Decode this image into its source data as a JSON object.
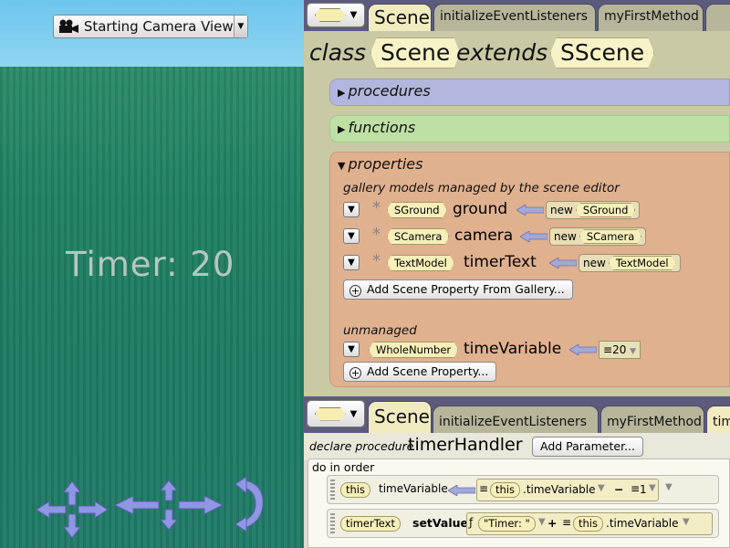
{
  "scene_view": {
    "camera_select": {
      "label": "Starting Camera View",
      "icon": "video-camera-icon"
    },
    "timer_text": "Timer: 20",
    "colors": {
      "sky": "#7ccbef",
      "ground": "#1f7d63"
    }
  },
  "editor_top": {
    "tabs": [
      "Scene",
      "initializeEventListeners",
      "myFirstMethod",
      ""
    ],
    "class_decl": {
      "class_kw": "class",
      "class_name": "Scene",
      "extends_kw": "extends",
      "super_name": "SScene"
    },
    "sections": {
      "procedures": "procedures",
      "functions": "functions",
      "properties": "properties"
    },
    "gallery_heading": "gallery models managed by the scene editor",
    "gallery_props": [
      {
        "type": "SGround",
        "name": "ground",
        "new_kw": "new",
        "new_type": "SGround"
      },
      {
        "type": "SCamera",
        "name": "camera",
        "new_kw": "new",
        "new_type": "SCamera"
      },
      {
        "type": "TextModel",
        "name": "timerText",
        "new_kw": "new",
        "new_type": "TextModel"
      }
    ],
    "add_from_gallery": "Add Scene Property From Gallery...",
    "unmanaged_heading": "unmanaged",
    "unmanaged_prop": {
      "type": "WholeNumber",
      "name": "timeVariable",
      "value": "20"
    },
    "add_scene_property": "Add Scene Property..."
  },
  "editor_bottom": {
    "tabs": [
      "Scene",
      "initializeEventListeners",
      "myFirstMethod",
      "time"
    ],
    "declare_kw": "declare procedure",
    "method_name": "timerHandler",
    "add_parameter": "Add Parameter...",
    "do_in_order": "do in order",
    "stmt1": {
      "target": "this",
      "field": "timeVariable",
      "expr_this": "this",
      "expr_field": ".timeVariable",
      "op": "−",
      "operand": "1"
    },
    "stmt2": {
      "target": "timerText",
      "method": "setValue",
      "str": "\"Timer: \"",
      "op": "+",
      "expr_this": "this",
      "expr_field": ".timeVariable"
    }
  }
}
